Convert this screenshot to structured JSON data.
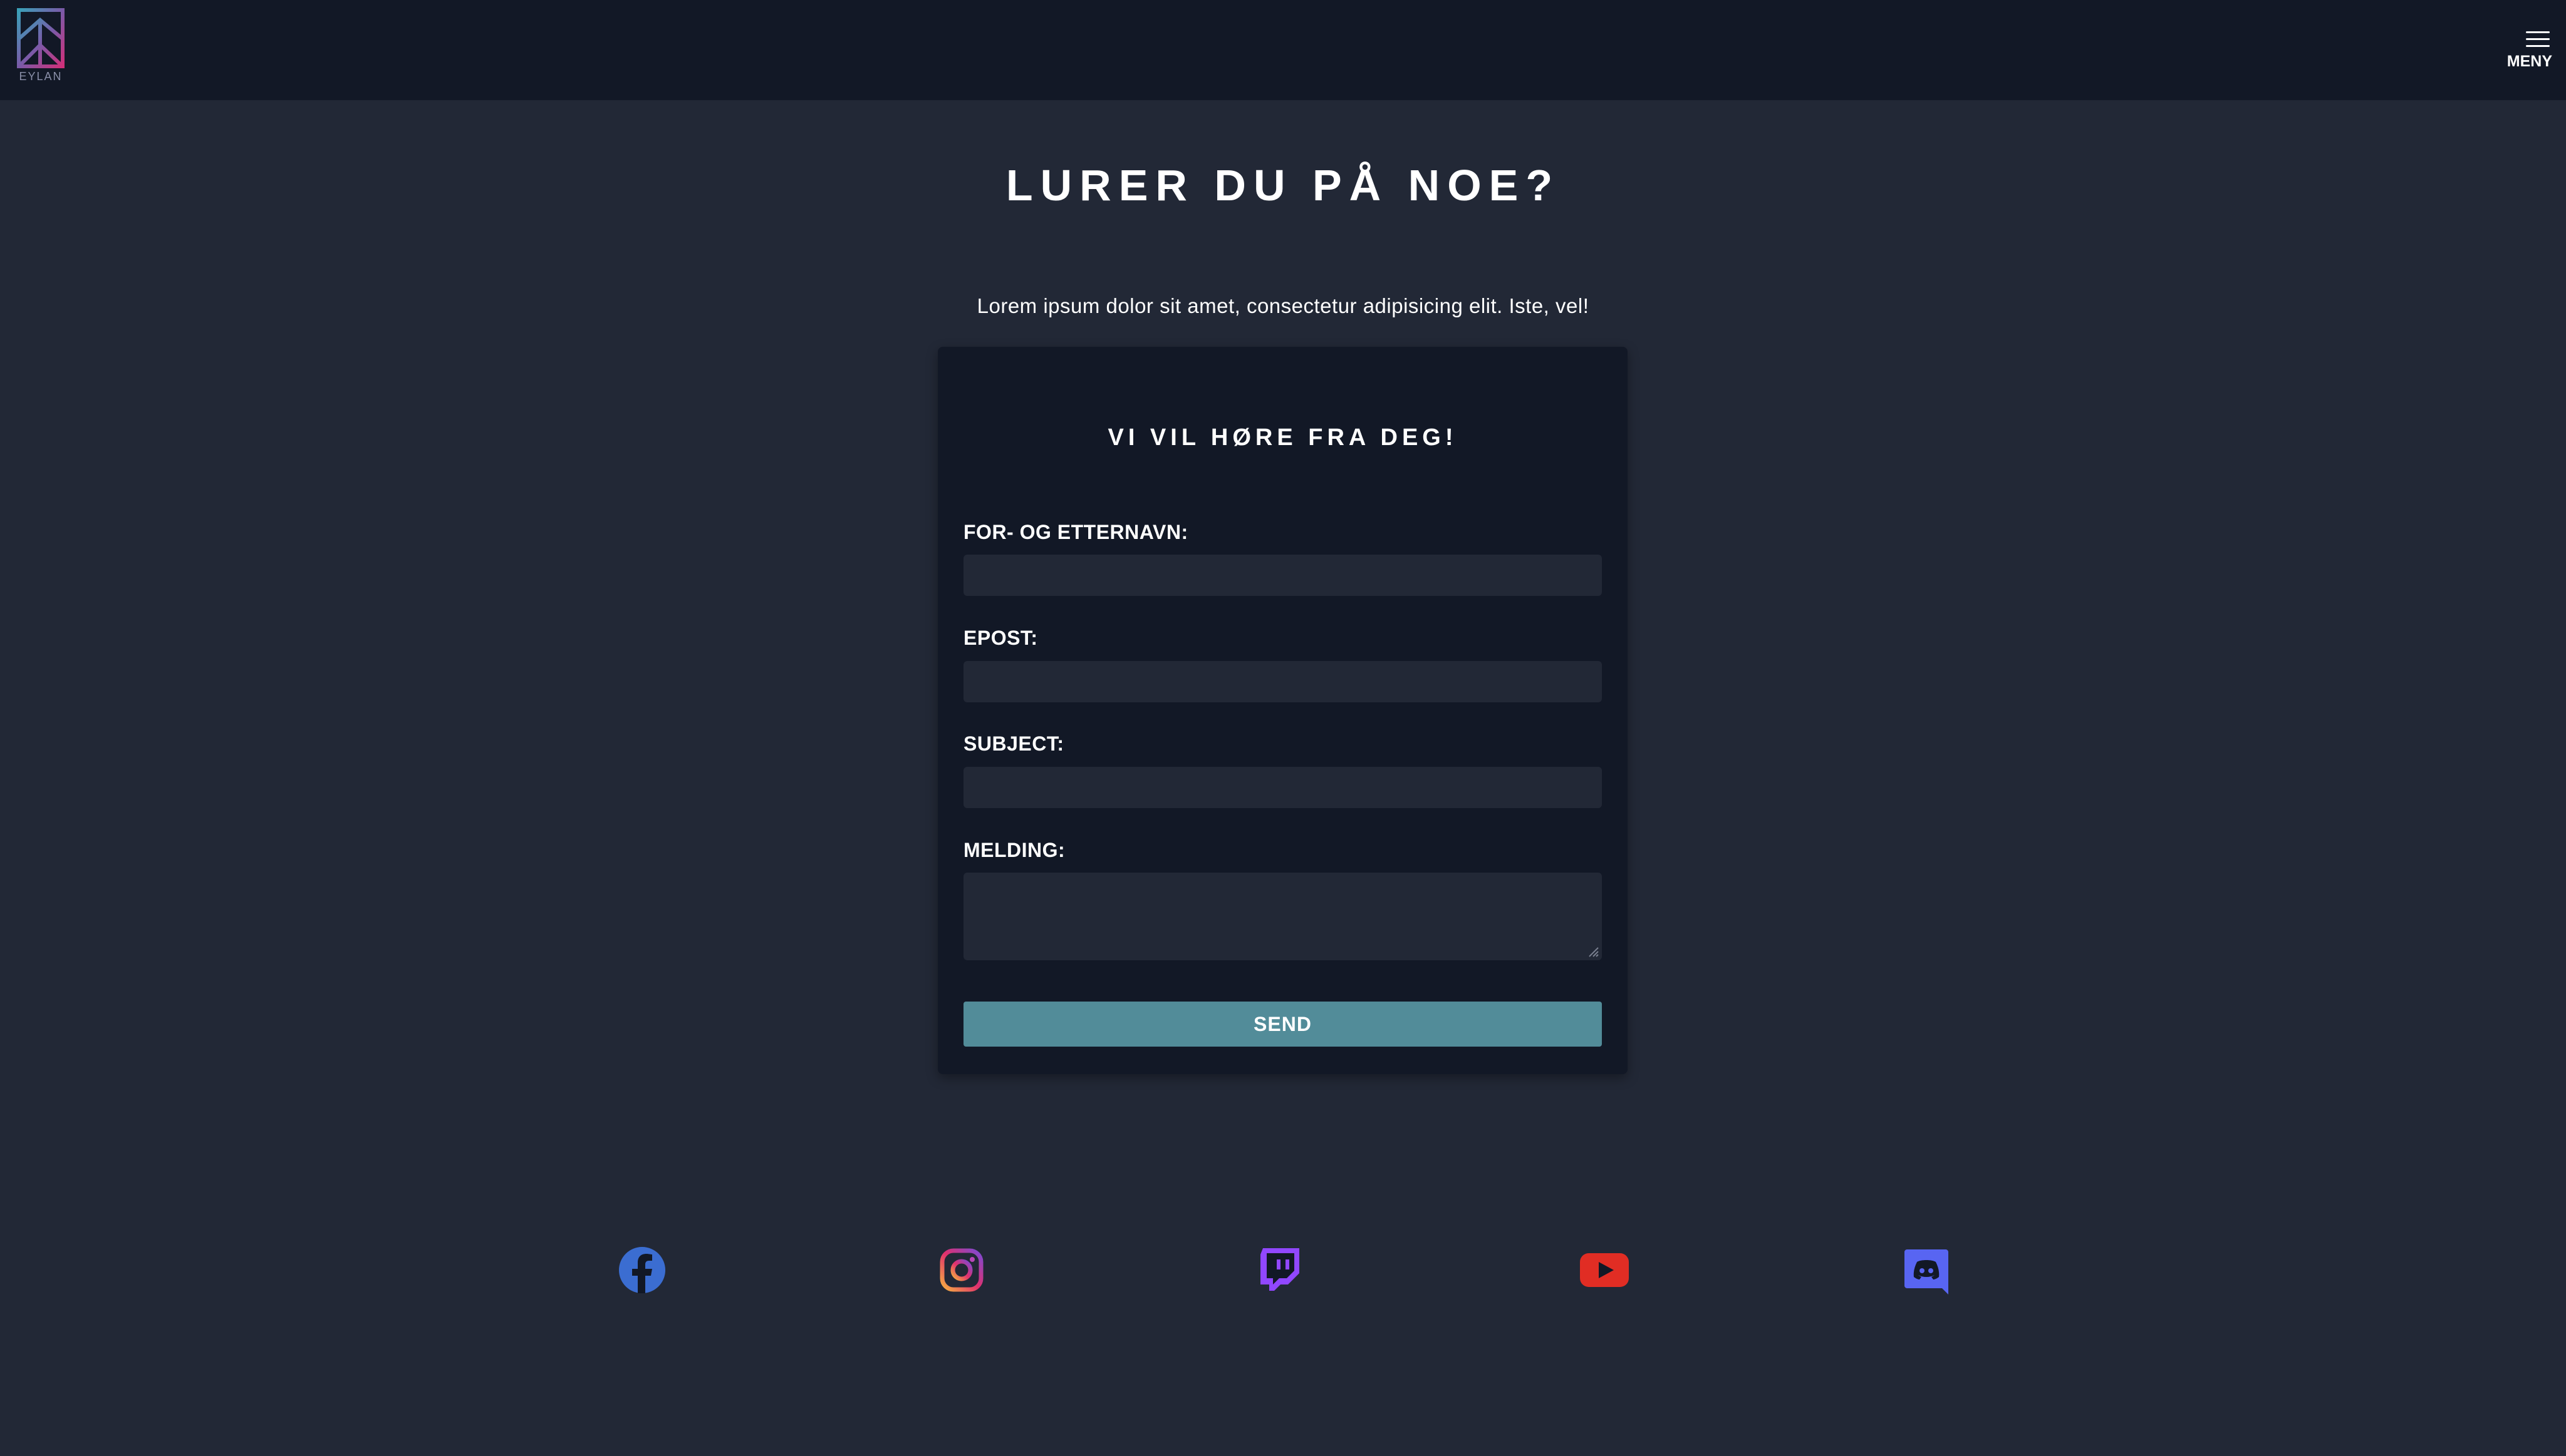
{
  "header": {
    "logo_text": "EYLAN",
    "menu_label": "MENY",
    "menu_icon": "hamburger-icon"
  },
  "main": {
    "title": "LURER DU PÅ NOE?",
    "intro": "Lorem ipsum dolor sit amet, consectetur adipisicing elit. Iste, vel!"
  },
  "form": {
    "title": "VI VIL HØRE FRA DEG!",
    "name_label": "FOR- OG ETTERNAVN:",
    "name_value": "",
    "email_label": "EPOST:",
    "email_value": "",
    "subject_label": "SUBJECT:",
    "subject_value": "",
    "message_label": "MELDING:",
    "message_value": "",
    "send_label": "SEND"
  },
  "social": [
    {
      "name": "facebook-icon",
      "color": "#3b6dd1"
    },
    {
      "name": "instagram-icon",
      "color": "#d6336c"
    },
    {
      "name": "twitch-icon",
      "color": "#9147ff"
    },
    {
      "name": "youtube-icon",
      "color": "#e12d24"
    },
    {
      "name": "discord-icon",
      "color": "#5865f2"
    }
  ],
  "colors": {
    "background": "#222836",
    "header": "#121826",
    "card": "#121826",
    "input": "#222836",
    "button": "#528c99"
  }
}
